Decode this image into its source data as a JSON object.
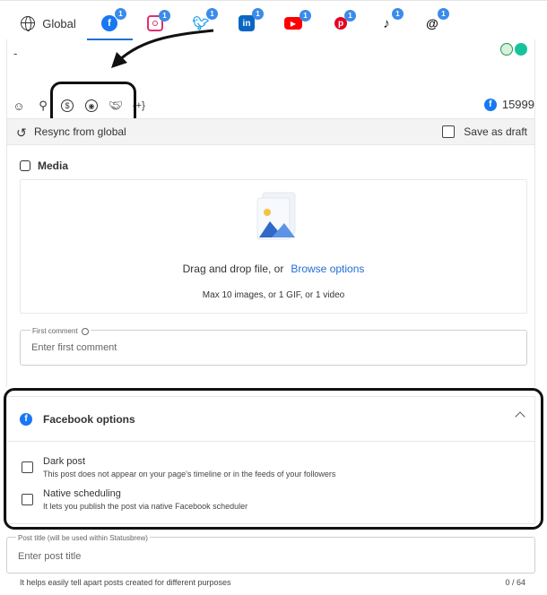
{
  "tabs": {
    "global_label": "Global",
    "networks": [
      {
        "name": "facebook",
        "badge": "1",
        "color": "#1877f2"
      },
      {
        "name": "instagram",
        "badge": "1",
        "color": "#e1306c"
      },
      {
        "name": "twitter",
        "badge": "1",
        "color": "#1da1f2"
      },
      {
        "name": "linkedin",
        "badge": "1",
        "color": "#0a66c2"
      },
      {
        "name": "youtube",
        "badge": "1",
        "color": "#ff0000"
      },
      {
        "name": "pinterest",
        "badge": "1",
        "color": "#e60023"
      },
      {
        "name": "tiktok",
        "badge": "1",
        "color": "#111111"
      },
      {
        "name": "threads",
        "badge": "1",
        "color": "#111111"
      }
    ]
  },
  "editor": {
    "text": "-",
    "variables_label": "{+}",
    "facebook_char_count": "15999"
  },
  "resync": {
    "label": "Resync from global",
    "save_draft_label": "Save as draft"
  },
  "media": {
    "title": "Media",
    "drag_text": "Drag and drop file, or",
    "browse_label": "Browse options",
    "limits": "Max 10 images, or 1 GIF, or 1 video"
  },
  "first_comment": {
    "label": "First comment",
    "placeholder": "Enter first comment"
  },
  "facebook_options": {
    "title": "Facebook options",
    "options": [
      {
        "title": "Dark post",
        "description": "This post does not appear on your page's timeline or in the feeds of your followers"
      },
      {
        "title": "Native scheduling",
        "description": "It lets you publish the post via native Facebook scheduler"
      }
    ]
  },
  "post_title": {
    "label": "Post title (will be used within Statusbrew)",
    "placeholder": "Enter post title",
    "help": "It helps easily tell apart posts created for different purposes",
    "counter": "0 / 64"
  },
  "colors": {
    "accent": "#1f6fd6",
    "facebook": "#1877f2"
  }
}
